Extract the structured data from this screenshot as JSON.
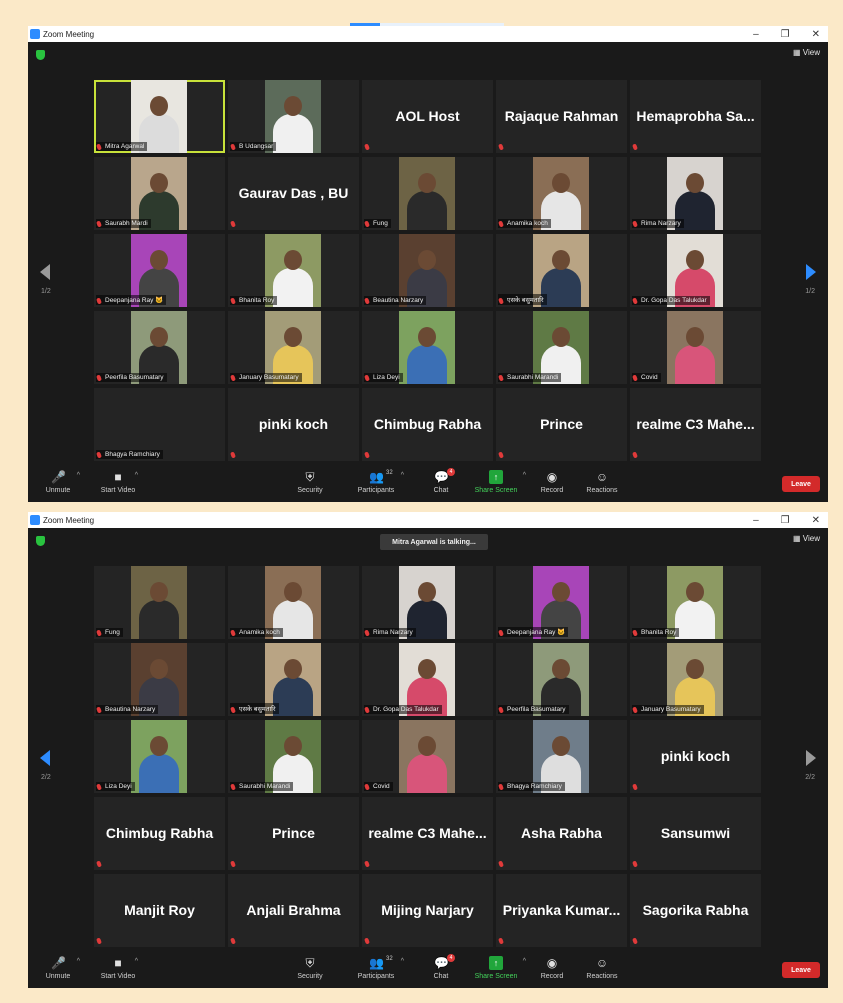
{
  "window1": {
    "title": "Zoom Meeting",
    "view_label": "View",
    "page_indicator_left": "1/2",
    "page_indicator_right": "1/2",
    "participants": [
      {
        "name": "Mitra Agarwal",
        "video": true,
        "active": true,
        "shirt": "#dcdcdc",
        "bg": "#e8e6e0"
      },
      {
        "name": "B Udangsar",
        "video": true,
        "shirt": "#f0f0f0",
        "bg": "#5c6b5a"
      },
      {
        "name": "AOL Host",
        "video": false
      },
      {
        "name": "Rajaque Rahman",
        "video": false
      },
      {
        "name": "Hemaprobha Sa...",
        "video": false
      },
      {
        "name": "Saurabh Mardi",
        "video": true,
        "shirt": "#2d3a2d",
        "bg": "#b9a68c"
      },
      {
        "name": "Gaurav Das , BU",
        "video": false
      },
      {
        "name": "Fung",
        "video": true,
        "shirt": "#2a2a2a",
        "bg": "#6d6345"
      },
      {
        "name": "Anamika koch",
        "video": true,
        "shirt": "#e6e6e6",
        "bg": "#8a6e55"
      },
      {
        "name": "Rima Narzary",
        "video": true,
        "shirt": "#1f2430",
        "bg": "#d7d3cf"
      },
      {
        "name": "Deepanjana Ray 🐱",
        "video": true,
        "shirt": "#444444",
        "bg": "#a845b8"
      },
      {
        "name": "Bhanita Roy",
        "video": true,
        "shirt": "#f2f2f2",
        "bg": "#8d9a63"
      },
      {
        "name": "Beautina Narzary",
        "video": true,
        "shirt": "#3b3b45",
        "bg": "#5a4030"
      },
      {
        "name": "एसके बसुमतारि",
        "video": true,
        "shirt": "#2c3c55",
        "bg": "#b9a484"
      },
      {
        "name": "Dr. Gopa Das Talukdar",
        "video": true,
        "shirt": "#d64a6a",
        "bg": "#e2ddd6"
      },
      {
        "name": "Peerfila Basumatary",
        "video": true,
        "shirt": "#2a2a2a",
        "bg": "#8e9a7a"
      },
      {
        "name": "January Basumatary",
        "video": true,
        "shirt": "#e6c55a",
        "bg": "#a39c78"
      },
      {
        "name": "Liza Deyi",
        "video": true,
        "shirt": "#3b6fb5",
        "bg": "#7da25f"
      },
      {
        "name": "Saurabhi Marandi",
        "video": true,
        "shirt": "#f0f0f0",
        "bg": "#5f7a45"
      },
      {
        "name": "Covid",
        "video": true,
        "shirt": "#d8557a",
        "bg": "#8a7560"
      },
      {
        "name": "Bhagya Ramchiary",
        "video": false,
        "hide_big": true
      },
      {
        "name": "pinki koch",
        "video": false
      },
      {
        "name": "Chimbug Rabha",
        "video": false
      },
      {
        "name": "Prince",
        "video": false
      },
      {
        "name": "realme C3 Mahe...",
        "video": false
      }
    ]
  },
  "window2": {
    "title": "Zoom Meeting",
    "view_label": "View",
    "talking_banner": "Mitra Agarwal is talking...",
    "page_indicator_left": "2/2",
    "page_indicator_right": "2/2",
    "participants": [
      {
        "name": "Fung",
        "video": true,
        "shirt": "#2a2a2a",
        "bg": "#6d6345"
      },
      {
        "name": "Anamika koch",
        "video": true,
        "shirt": "#e6e6e6",
        "bg": "#8a6e55"
      },
      {
        "name": "Rima Narzary",
        "video": true,
        "shirt": "#1f2430",
        "bg": "#d7d3cf"
      },
      {
        "name": "Deepanjana Ray 🐱",
        "video": true,
        "shirt": "#444444",
        "bg": "#a845b8"
      },
      {
        "name": "Bhanita Roy",
        "video": true,
        "shirt": "#f2f2f2",
        "bg": "#8d9a63"
      },
      {
        "name": "Beautina Narzary",
        "video": true,
        "shirt": "#3b3b45",
        "bg": "#5a4030"
      },
      {
        "name": "एसके बसुमतारि",
        "video": true,
        "shirt": "#2c3c55",
        "bg": "#b9a484"
      },
      {
        "name": "Dr. Gopa Das Talukdar",
        "video": true,
        "shirt": "#d64a6a",
        "bg": "#e2ddd6"
      },
      {
        "name": "Peerfila Basumatary",
        "video": true,
        "shirt": "#2a2a2a",
        "bg": "#8e9a7a"
      },
      {
        "name": "January Basumatary",
        "video": true,
        "shirt": "#e6c55a",
        "bg": "#a39c78"
      },
      {
        "name": "Liza Deyi",
        "video": true,
        "shirt": "#3b6fb5",
        "bg": "#7da25f"
      },
      {
        "name": "Saurabhi Marandi",
        "video": true,
        "shirt": "#f0f0f0",
        "bg": "#5f7a45"
      },
      {
        "name": "Covid",
        "video": true,
        "shirt": "#d8557a",
        "bg": "#8a7560"
      },
      {
        "name": "Bhagya Ramchiary",
        "video": true,
        "shirt": "#dedede",
        "bg": "#6f7d8a"
      },
      {
        "name": "pinki koch",
        "video": false
      },
      {
        "name": "Chimbug Rabha",
        "video": false
      },
      {
        "name": "Prince",
        "video": false
      },
      {
        "name": "realme C3 Mahe...",
        "video": false
      },
      {
        "name": "Asha Rabha",
        "video": false
      },
      {
        "name": "Sansumwi",
        "video": false
      },
      {
        "name": "Manjit Roy",
        "video": false
      },
      {
        "name": "Anjali Brahma",
        "video": false
      },
      {
        "name": "Mijing Narjary",
        "video": false
      },
      {
        "name": "Priyanka  Kumar...",
        "video": false
      },
      {
        "name": "Sagorika Rabha",
        "video": false
      }
    ]
  },
  "toolbar": {
    "unmute": "Unmute",
    "start_video": "Start Video",
    "security": "Security",
    "participants": "Participants",
    "participant_count": "32",
    "chat": "Chat",
    "chat_badge": "4",
    "share_screen": "Share Screen",
    "record": "Record",
    "reactions": "Reactions",
    "leave": "Leave"
  },
  "colors": {
    "accent_blue": "#2d8cff",
    "leave_red": "#d32a2a",
    "share_green": "#21a63b",
    "active_speaker": "#c8e23a"
  }
}
